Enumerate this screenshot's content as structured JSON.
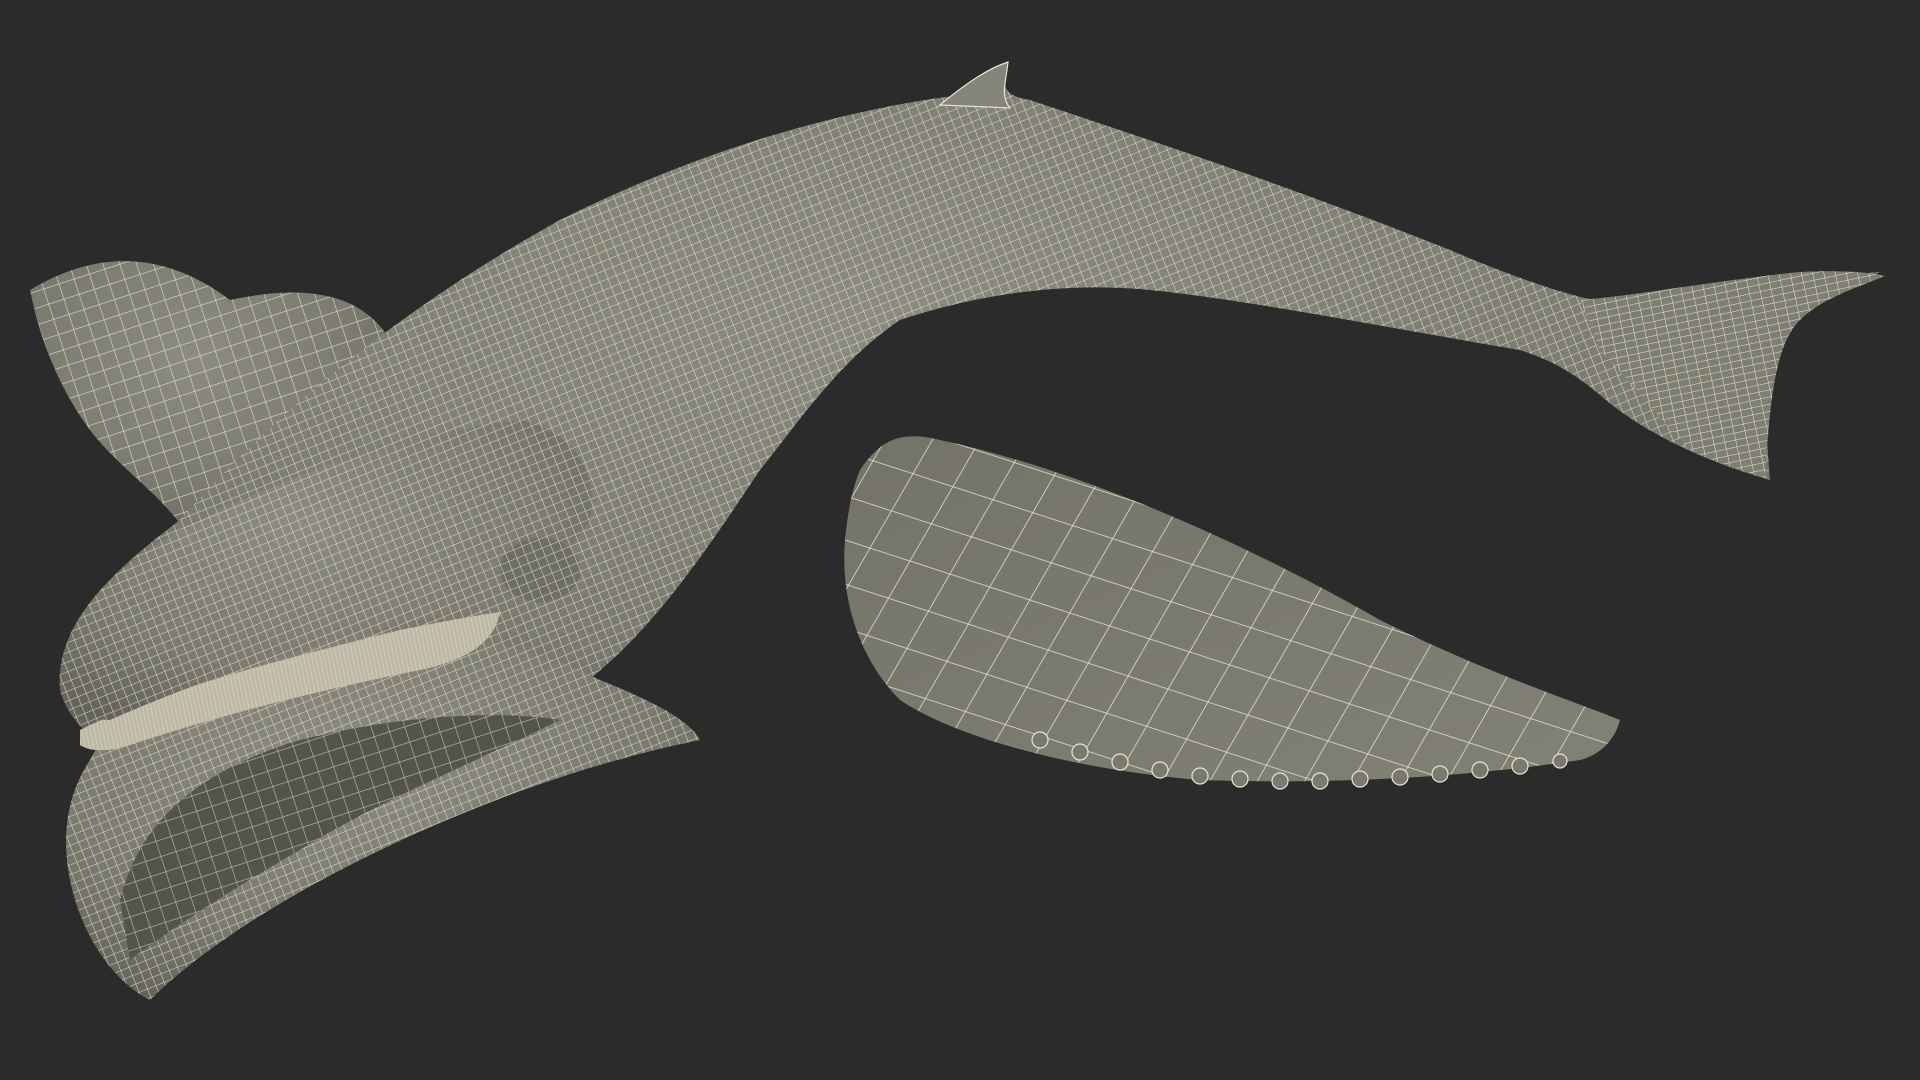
{
  "scene": {
    "subject": "humpback-whale-wireframe",
    "colors": {
      "background": "#2b2b2b",
      "mesh_fill": "#7d7c70",
      "mesh_fill_light": "#8a897d",
      "mesh_fill_dark": "#64635a",
      "wire": "#e9e6d4",
      "shadow": "#3a3a36"
    }
  }
}
